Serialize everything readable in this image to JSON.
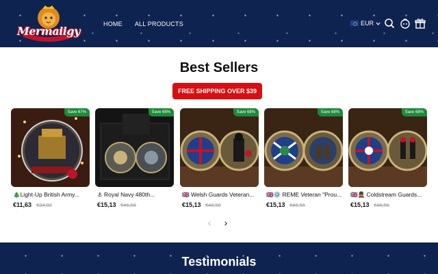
{
  "header": {
    "logo_text": "Mermaiigy",
    "nav": [
      "HOME",
      "ALL PRODUCTS"
    ],
    "currency": "EUR",
    "icons": [
      "search-icon",
      "account-icon",
      "gift-icon"
    ]
  },
  "section": {
    "title": "Best Sellers",
    "shipping_button": "FREE SHIPPING OVER $39"
  },
  "products": [
    {
      "name": "🎄Light-Up British Army...",
      "price": "€11,63",
      "old_price": "€34,92",
      "badge": "Save 67%"
    },
    {
      "name": "⚓ Royal Navy 480th...",
      "price": "€15,13",
      "old_price": "€46,56",
      "badge": "Save 68%"
    },
    {
      "name": "🇬🇧 Welsh Guards Veteran...",
      "price": "€15,13",
      "old_price": "€46,56",
      "badge": "Save 68%"
    },
    {
      "name": "🇬🇧⚙️ REME Veteran \"Prou...",
      "price": "€15,13",
      "old_price": "€46,56",
      "badge": "Save 68%"
    },
    {
      "name": "🇬🇧💂 Coldstream Guards...",
      "price": "€15,13",
      "old_price": "€46,56",
      "badge": "Save 68%"
    }
  ],
  "pager": {
    "prev": "‹",
    "next": "›"
  },
  "testimonials": {
    "title": "Testimonials"
  }
}
